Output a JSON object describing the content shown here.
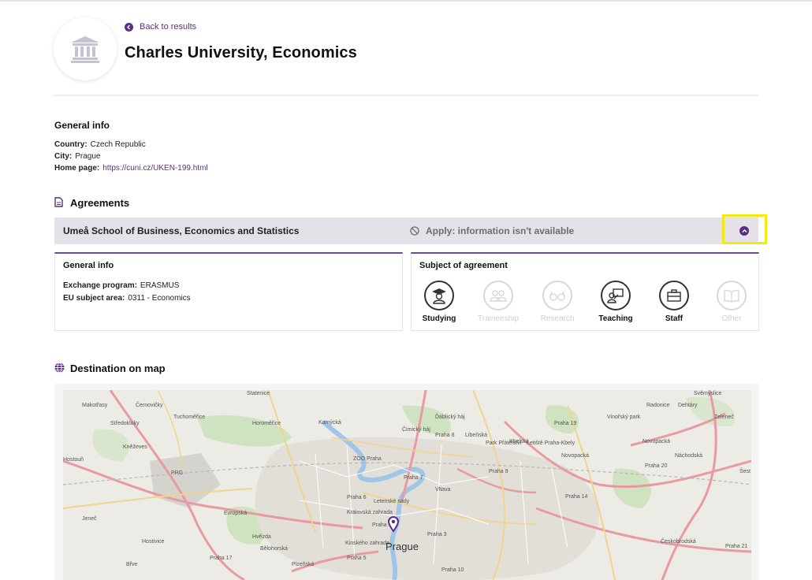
{
  "header": {
    "back_label": "Back to results",
    "title": "Charles University, Economics"
  },
  "general": {
    "title": "General info",
    "country_label": "Country:",
    "country_value": "Czech Republic",
    "city_label": "City:",
    "city_value": "Prague",
    "homepage_label": "Home page:",
    "homepage_value": "https://cuni.cz/UKEN-199.html"
  },
  "agreements": {
    "title": "Agreements",
    "partner": "Umeå School of Business, Economics and Statistics",
    "apply_status": "Apply: information isn't available",
    "info": {
      "title": "General info",
      "program_label": "Exchange program:",
      "program_value": "ERASMUS",
      "area_label": "EU subject area:",
      "area_value": "0311 - Economics"
    },
    "subject": {
      "title": "Subject of agreement",
      "items": [
        {
          "label": "Studying",
          "active": true,
          "icon": "student-icon"
        },
        {
          "label": "Traineeship",
          "active": false,
          "icon": "group-icon"
        },
        {
          "label": "Research",
          "active": false,
          "icon": "glasses-icon"
        },
        {
          "label": "Teaching",
          "active": true,
          "icon": "teacher-icon"
        },
        {
          "label": "Staff",
          "active": true,
          "icon": "briefcase-icon"
        },
        {
          "label": "Other",
          "active": false,
          "icon": "book-icon"
        }
      ]
    }
  },
  "map": {
    "title": "Destination on map",
    "city": "Prague",
    "labels": {
      "statenice": "Statenice",
      "svemyslice": "Švěmyslice",
      "makotasy": "Makotřasy",
      "cernovicky": "Černovičky",
      "tuchomerice": "Tuchoměřice",
      "horomerice": "Horoměřice",
      "radonice": "Radonice",
      "dehtary": "Dehtáry",
      "zelenec": "Zeleneč",
      "stredokluky": "Středokluky",
      "kamycka": "Kamýcká",
      "dablicky": "Ďáblický háj",
      "praha19": "Praha 19",
      "vinorsky": "Vinořský park",
      "praha8": "Praha 8",
      "cimicky": "Čimický háj",
      "libenska": "Libeňská",
      "knezeves": "Kněževes",
      "kbelska": "Kbelská",
      "park": "Park Přátelství",
      "letiste": "Letiště Praha-Kbely",
      "novopacka1": "Novopacká",
      "novopacka2": "Novopacká",
      "zoo": "ZOO Praha",
      "nachodska": "Náchodská",
      "hostoun": "Hostouň",
      "praha7": "Praha 7",
      "praha9": "Praha 9",
      "praha20": "Praha 20",
      "sest": "Šest",
      "prg": "PRG",
      "vltava": "Vltava",
      "praha6": "Praha 6",
      "praha14": "Praha 14",
      "letenske": "Letenské sady",
      "jenec": "Jeneč",
      "evropska": "Evropská",
      "kralovska": "Královská zahrada",
      "hvezda": "Hvězda",
      "hostivice": "Hostivice",
      "praha3": "Praha 3",
      "praha1": "Praha 1",
      "ceskobrodska": "Českobrodská",
      "praha21": "Praha 21",
      "kinskeho": "Kinského zahrada",
      "belohorska": "Bělohorská",
      "praha17": "Praha 17",
      "praha5": "Praha 5",
      "praha10": "Praha 10",
      "plzenska": "Plzeňská",
      "brve": "Břve"
    }
  },
  "colors": {
    "accent": "#5b2d86",
    "highlight": "#f5ea10",
    "agreement_bar": "#e4e1e8"
  }
}
